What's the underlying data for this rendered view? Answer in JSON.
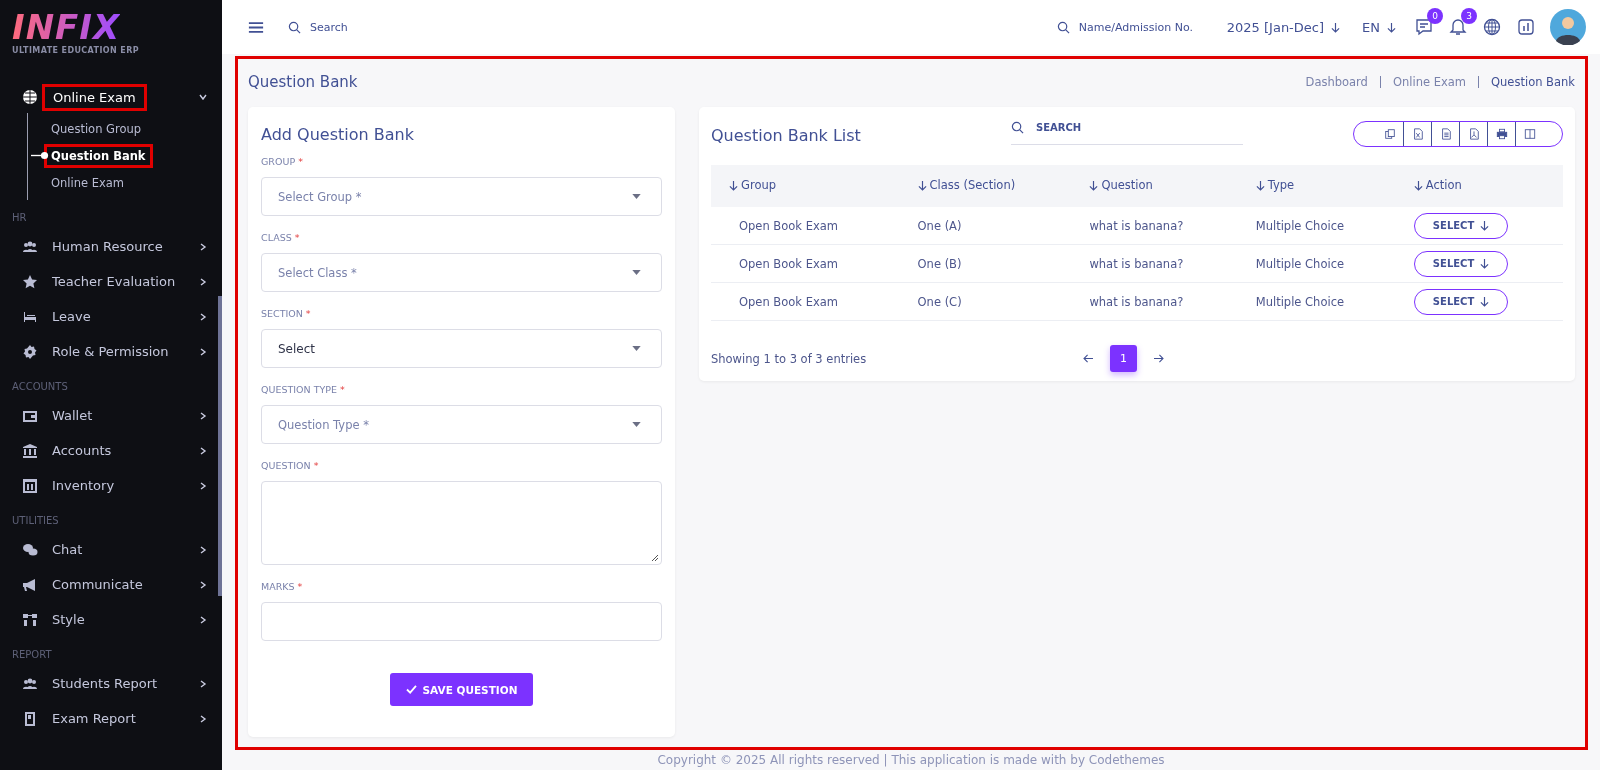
{
  "sidebar": {
    "logo": {
      "text": "INFIX",
      "tagline": "ULTIMATE EDUCATION ERP"
    },
    "active_menu": {
      "label": "Online Exam",
      "expanded": true,
      "highlighted": true,
      "children": [
        {
          "label": "Question Group",
          "selected": false,
          "highlighted": false
        },
        {
          "label": "Question Bank",
          "selected": true,
          "highlighted": true
        },
        {
          "label": "Online Exam",
          "selected": false,
          "highlighted": false
        }
      ]
    },
    "sections": [
      {
        "title": "HR",
        "items": [
          "Human Resource",
          "Teacher Evaluation",
          "Leave",
          "Role & Permission"
        ]
      },
      {
        "title": "ACCOUNTS",
        "items": [
          "Wallet",
          "Accounts",
          "Inventory"
        ]
      },
      {
        "title": "UTILITIES",
        "items": [
          "Chat",
          "Communicate",
          "Style"
        ]
      },
      {
        "title": "REPORT",
        "items": [
          "Students Report",
          "Exam Report"
        ]
      }
    ]
  },
  "header": {
    "search": {
      "placeholder": "Search"
    },
    "student_search": {
      "placeholder": "Name/Admission No."
    },
    "session": "2025 [Jan-Dec]",
    "language": "EN",
    "messages_badge": "0",
    "notifications_badge": "3"
  },
  "page": {
    "title": "Question Bank",
    "highlighted": true,
    "breadcrumb": [
      "Dashboard",
      "Online Exam",
      "Question Bank"
    ]
  },
  "form": {
    "title": "Add Question Bank",
    "fields": [
      {
        "kind": "select",
        "label": "GROUP",
        "required_mark": "*",
        "placeholder": "Select Group *"
      },
      {
        "kind": "select",
        "label": "CLASS",
        "required_mark": "*",
        "placeholder": "Select Class *"
      },
      {
        "kind": "select",
        "label": "SECTION",
        "required_mark": "*",
        "value": "Select"
      },
      {
        "kind": "select",
        "label": "QUESTION TYPE",
        "required_mark": "*",
        "placeholder": "Question Type *"
      },
      {
        "kind": "textarea",
        "label": "QUESTION",
        "required_mark": "*"
      },
      {
        "kind": "input",
        "label": "MARKS",
        "required_mark": "*"
      }
    ],
    "submit": "SAVE QUESTION"
  },
  "list": {
    "title": "Question Bank List",
    "search": {
      "placeholder": "SEARCH"
    },
    "columns": [
      "Group",
      "Class (Section)",
      "Question",
      "Type",
      "Action"
    ],
    "rows": [
      [
        "Open Book Exam",
        "One (A)",
        "what is banana?",
        "Multiple Choice",
        "SELECT"
      ],
      [
        "Open Book Exam",
        "One (B)",
        "what is banana?",
        "Multiple Choice",
        "SELECT"
      ],
      [
        "Open Book Exam",
        "One (C)",
        "what is banana?",
        "Multiple Choice",
        "SELECT"
      ]
    ],
    "info": "Showing 1 to 3 of 3 entries",
    "pages": [
      {
        "label": "1",
        "selected": true
      }
    ]
  },
  "footer": "Copyright © 2025 All rights reserved | This application is made with by Codethemes"
}
